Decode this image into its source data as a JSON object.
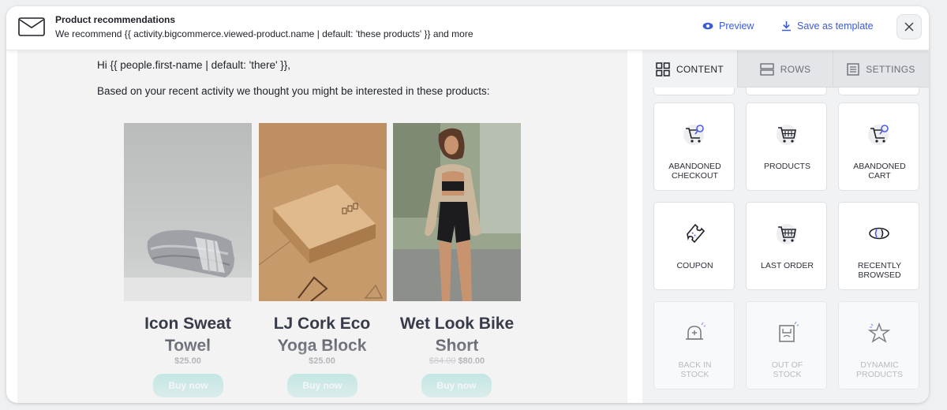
{
  "header": {
    "title": "Product recommendations",
    "subtitle": "We recommend {{ activity.bigcommerce.viewed-product.name | default: 'these products' }} and more",
    "preview_label": "Preview",
    "save_label": "Save as template"
  },
  "email": {
    "greeting": "Hi {{ people.first-name | default: 'there' }},",
    "intro": "Based on your recent activity we thought you might be interested in these products:",
    "button_color": "#6fd0c6",
    "products": [
      {
        "name_line1": "Icon Sweat",
        "name_line2": "Towel",
        "old_price": "",
        "price": "$25.00",
        "button": "Buy now"
      },
      {
        "name_line1": "LJ Cork Eco",
        "name_line2": "Yoga Block",
        "old_price": "",
        "price": "$25.00",
        "button": "Buy now"
      },
      {
        "name_line1": "Wet Look Bike",
        "name_line2": "Short",
        "old_price": "$84.00",
        "price": "$80.00",
        "button": "Buy now"
      }
    ]
  },
  "sidebar": {
    "tabs": [
      {
        "label": "CONTENT",
        "icon": "grid-icon",
        "active": true
      },
      {
        "label": "ROWS",
        "icon": "rows-icon",
        "active": false
      },
      {
        "label": "SETTINGS",
        "icon": "settings-icon",
        "active": false
      }
    ],
    "blocks": [
      {
        "line1": "ABANDONED",
        "line2": "CHECKOUT",
        "icon": "cart-checkout-icon"
      },
      {
        "line1": "PRODUCTS",
        "line2": "",
        "icon": "cart-icon"
      },
      {
        "line1": "ABANDONED",
        "line2": "CART",
        "icon": "cart-abandoned-icon"
      },
      {
        "line1": "COUPON",
        "line2": "",
        "icon": "coupon-icon"
      },
      {
        "line1": "LAST ORDER",
        "line2": "",
        "icon": "last-order-icon"
      },
      {
        "line1": "RECENTLY",
        "line2": "BROWSED",
        "icon": "eye-icon"
      },
      {
        "line1": "BACK IN",
        "line2": "STOCK",
        "icon": "bell-icon"
      },
      {
        "line1": "OUT OF",
        "line2": "STOCK",
        "icon": "empty-box-icon"
      },
      {
        "line1": "DYNAMIC",
        "line2": "PRODUCTS",
        "icon": "star-icon"
      }
    ]
  }
}
